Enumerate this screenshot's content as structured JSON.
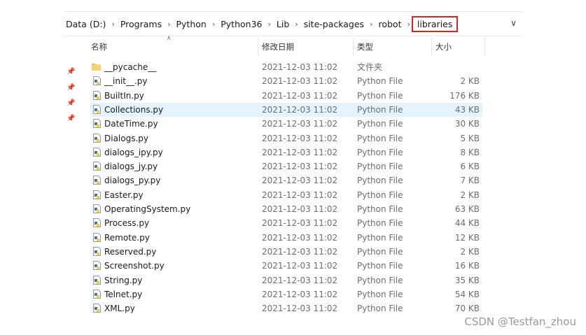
{
  "address": {
    "crumbs": [
      "Data (D:)",
      "Programs",
      "Python",
      "Python36",
      "Lib",
      "site-packages",
      "robot",
      "libraries"
    ],
    "highlighted": "libraries"
  },
  "columns": {
    "name": "名称",
    "date": "修改日期",
    "type": "类型",
    "size": "大小"
  },
  "files": [
    {
      "name": "__pycache__",
      "date": "2021-12-03 11:02",
      "type": "文件夹",
      "size": "",
      "icon": "folder-icon"
    },
    {
      "name": "__init__.py",
      "date": "2021-12-03 11:02",
      "type": "Python File",
      "size": "2 KB",
      "icon": "python-file-icon"
    },
    {
      "name": "BuiltIn.py",
      "date": "2021-12-03 11:02",
      "type": "Python File",
      "size": "176 KB",
      "icon": "python-file-icon"
    },
    {
      "name": "Collections.py",
      "date": "2021-12-03 11:02",
      "type": "Python File",
      "size": "43 KB",
      "icon": "python-file-icon"
    },
    {
      "name": "DateTime.py",
      "date": "2021-12-03 11:02",
      "type": "Python File",
      "size": "30 KB",
      "icon": "python-file-icon"
    },
    {
      "name": "Dialogs.py",
      "date": "2021-12-03 11:02",
      "type": "Python File",
      "size": "5 KB",
      "icon": "python-file-icon"
    },
    {
      "name": "dialogs_ipy.py",
      "date": "2021-12-03 11:02",
      "type": "Python File",
      "size": "8 KB",
      "icon": "python-file-icon"
    },
    {
      "name": "dialogs_jy.py",
      "date": "2021-12-03 11:02",
      "type": "Python File",
      "size": "6 KB",
      "icon": "python-file-icon"
    },
    {
      "name": "dialogs_py.py",
      "date": "2021-12-03 11:02",
      "type": "Python File",
      "size": "7 KB",
      "icon": "python-file-icon"
    },
    {
      "name": "Easter.py",
      "date": "2021-12-03 11:02",
      "type": "Python File",
      "size": "2 KB",
      "icon": "python-file-icon"
    },
    {
      "name": "OperatingSystem.py",
      "date": "2021-12-03 11:02",
      "type": "Python File",
      "size": "63 KB",
      "icon": "python-file-icon"
    },
    {
      "name": "Process.py",
      "date": "2021-12-03 11:02",
      "type": "Python File",
      "size": "44 KB",
      "icon": "python-file-icon"
    },
    {
      "name": "Remote.py",
      "date": "2021-12-03 11:02",
      "type": "Python File",
      "size": "12 KB",
      "icon": "python-file-icon"
    },
    {
      "name": "Reserved.py",
      "date": "2021-12-03 11:02",
      "type": "Python File",
      "size": "2 KB",
      "icon": "python-file-icon"
    },
    {
      "name": "Screenshot.py",
      "date": "2021-12-03 11:02",
      "type": "Python File",
      "size": "16 KB",
      "icon": "python-file-icon"
    },
    {
      "name": "String.py",
      "date": "2021-12-03 11:02",
      "type": "Python File",
      "size": "35 KB",
      "icon": "python-file-icon"
    },
    {
      "name": "Telnet.py",
      "date": "2021-12-03 11:02",
      "type": "Python File",
      "size": "54 KB",
      "icon": "python-file-icon"
    },
    {
      "name": "XML.py",
      "date": "2021-12-03 11:02",
      "type": "Python File",
      "size": "70 KB",
      "icon": "python-file-icon"
    }
  ],
  "selected_file": "Collections.py",
  "watermark": "CSDN @Testfan_zhou",
  "colors": {
    "highlight_border": "#e0211c",
    "row_selected": "#cce8ff",
    "folder": "#f0c24a",
    "python_blue": "#3a75b0",
    "python_yellow": "#f3cf3a"
  }
}
